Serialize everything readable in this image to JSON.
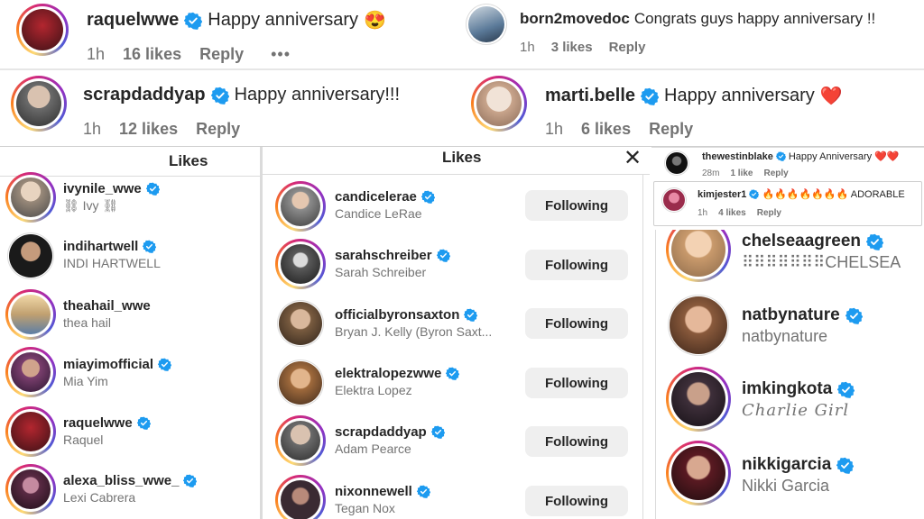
{
  "comments_top": [
    {
      "user": "raquelwwe",
      "text": "Happy anniversary",
      "emoji": "😍",
      "time": "1h",
      "likes": "16 likes",
      "reply": "Reply",
      "more": "•••"
    },
    {
      "user": "born2movedoc",
      "text": "Congrats guys happy anniversary !!",
      "time": "1h",
      "likes": "3 likes",
      "reply": "Reply"
    },
    {
      "user": "scrapdaddyap",
      "text": "Happy anniversary!!!",
      "time": "1h",
      "likes": "12 likes",
      "reply": "Reply"
    },
    {
      "user": "marti.belle",
      "text": "Happy anniversary",
      "emoji": "❤️",
      "time": "1h",
      "likes": "6 likes",
      "reply": "Reply"
    }
  ],
  "likes_left": {
    "title": "Likes",
    "rows": [
      {
        "user": "ivynile_wwe",
        "name": "⛓ Ivy ⛓"
      },
      {
        "user": "indihartwell",
        "name": "INDI HARTWELL"
      },
      {
        "user": "theahail_wwe",
        "name": "thea hail"
      },
      {
        "user": "miayimofficial",
        "name": "Mia Yim"
      },
      {
        "user": "raquelwwe",
        "name": "Raquel"
      },
      {
        "user": "alexa_bliss_wwe_",
        "name": "Lexi Cabrera"
      }
    ]
  },
  "likes_mid": {
    "title": "Likes",
    "close": "✕",
    "button": "Following",
    "rows": [
      {
        "user": "candicelerae",
        "name": "Candice LeRae"
      },
      {
        "user": "sarahschreiber",
        "name": "Sarah Schreiber"
      },
      {
        "user": "officialbyronsaxton",
        "name": "Bryan J. Kelly (Byron Saxt..."
      },
      {
        "user": "elektralopezwwe",
        "name": "Elektra Lopez"
      },
      {
        "user": "scrapdaddyap",
        "name": "Adam Pearce"
      },
      {
        "user": "nixonnewell",
        "name": "Tegan Nox"
      }
    ]
  },
  "small_comments": [
    {
      "user": "thewestinblake",
      "text": "Happy Anniversary",
      "emoji": "❤️❤️",
      "time": "28m",
      "likes": "1 like",
      "reply": "Reply"
    },
    {
      "user": "kimjester1",
      "text": "🔥🔥🔥🔥🔥🔥🔥 ADORABLE",
      "time": "1h",
      "likes": "4 likes",
      "reply": "Reply"
    }
  ],
  "likes_right": {
    "rows": [
      {
        "user": "chelseaagreen",
        "name": "⠿⠿⠿⠿⠿⠿⠿CHELSEA"
      },
      {
        "user": "natbynature",
        "name": "natbynature"
      },
      {
        "user": "imkingkota",
        "name": "Charlie Girl"
      },
      {
        "user": "nikkigarcia",
        "name": "Nikki Garcia"
      }
    ]
  },
  "colors": {
    "verified": "#1d9bf0",
    "meta": "#737373",
    "button_bg": "#efefef",
    "heart": "#e0245e"
  }
}
